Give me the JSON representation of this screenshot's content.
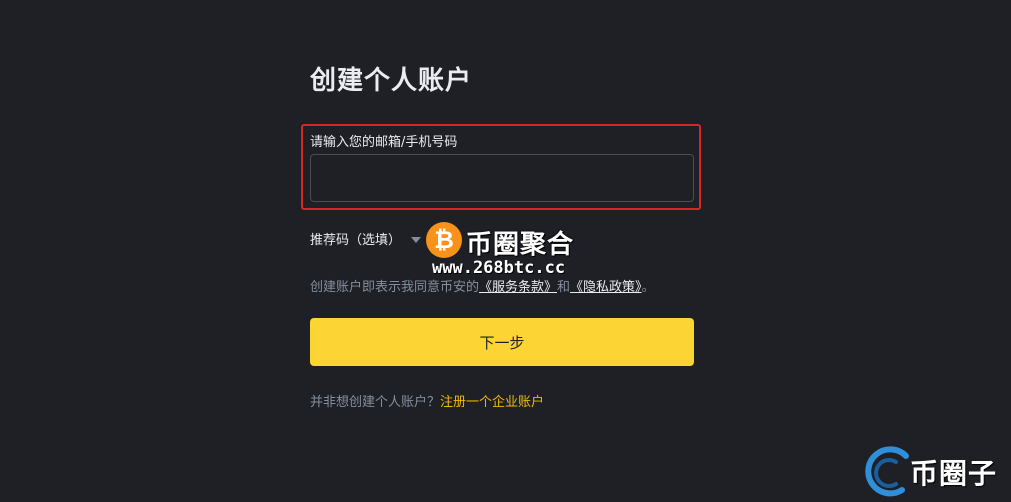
{
  "page": {
    "title": "创建个人账户"
  },
  "form": {
    "account_label": "请输入您的邮箱/手机号码",
    "account_value": "",
    "referral_label": "推荐码（选填）",
    "terms_prefix": "创建账户即表示我同意币安的",
    "terms_link_service": "《服务条款》",
    "terms_and": "和",
    "terms_link_privacy": "《隐私政策》",
    "terms_suffix": "。",
    "next_label": "下一步"
  },
  "footer": {
    "prompt": "并非想创建个人账户？",
    "link": "注册一个企业账户"
  },
  "watermarks": {
    "center_glyph": "₿",
    "center_title": "币圈聚合",
    "center_url": "www.268btc.cc",
    "corner_text": "币圈子"
  },
  "colors": {
    "background": "#1e2026",
    "accent_yellow": "#fcd535",
    "link_yellow": "#f0b90b",
    "highlight_red": "#d9252a"
  }
}
